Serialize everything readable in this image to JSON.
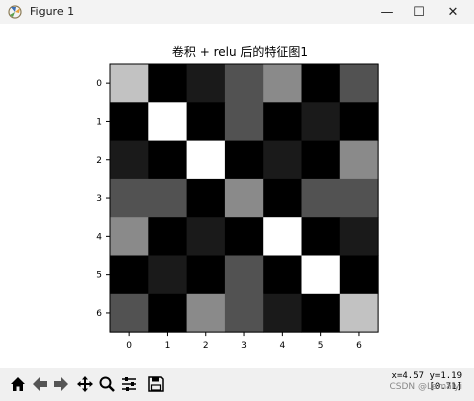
{
  "window": {
    "title": "Figure 1",
    "controls": {
      "minimize": "—",
      "maximize": "☐",
      "close": "✕"
    }
  },
  "toolbar": {
    "icons": [
      "home-icon",
      "back-arrow-icon",
      "forward-arrow-icon",
      "pan-move-icon",
      "zoom-rect-icon",
      "configure-subplots-icon",
      "save-icon"
    ],
    "coords_line1": "x=4.57 y=1.19",
    "coords_line2": "[0.71]",
    "watermark": "CSDN @Lemalyi"
  },
  "chart_data": {
    "type": "heatmap",
    "title": "卷积 + relu 后的特征图1",
    "xlabel": "",
    "ylabel": "",
    "x_ticks": [
      "0",
      "1",
      "2",
      "3",
      "4",
      "5",
      "6"
    ],
    "y_ticks": [
      "0",
      "1",
      "2",
      "3",
      "4",
      "5",
      "6"
    ],
    "colormap": "gray",
    "values": [
      [
        0.76,
        0.0,
        0.1,
        0.32,
        0.54,
        0.0,
        0.32
      ],
      [
        0.0,
        1.0,
        0.0,
        0.32,
        0.0,
        0.1,
        0.0
      ],
      [
        0.1,
        0.0,
        1.0,
        0.0,
        0.1,
        0.0,
        0.54
      ],
      [
        0.32,
        0.32,
        0.0,
        0.54,
        0.0,
        0.32,
        0.32
      ],
      [
        0.54,
        0.0,
        0.1,
        0.0,
        1.0,
        0.0,
        0.1
      ],
      [
        0.0,
        0.1,
        0.0,
        0.32,
        0.0,
        1.0,
        0.0
      ],
      [
        0.32,
        0.0,
        0.54,
        0.32,
        0.1,
        0.0,
        0.76
      ]
    ]
  }
}
